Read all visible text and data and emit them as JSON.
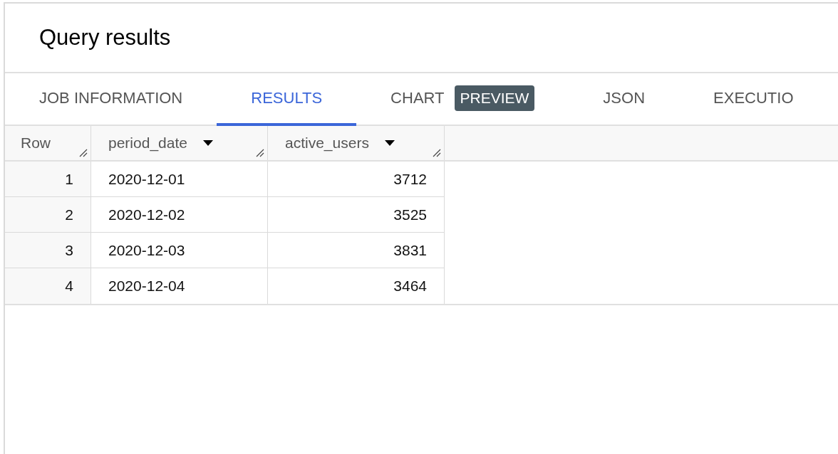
{
  "title": "Query results",
  "tabs": [
    {
      "label": "JOB INFORMATION",
      "selected": false
    },
    {
      "label": "RESULTS",
      "selected": true
    },
    {
      "label": "CHART",
      "badge": "PREVIEW",
      "selected": false
    },
    {
      "label": "JSON",
      "selected": false
    },
    {
      "label": "EXECUTIO",
      "selected": false
    }
  ],
  "table": {
    "columns": [
      {
        "label": "Row",
        "kind": "index",
        "menu": false
      },
      {
        "label": "period_date",
        "kind": "text",
        "menu": true
      },
      {
        "label": "active_users",
        "kind": "number",
        "menu": true
      }
    ],
    "rows": [
      [
        "1",
        "2020-12-01",
        "3712"
      ],
      [
        "2",
        "2020-12-02",
        "3525"
      ],
      [
        "3",
        "2020-12-03",
        "3831"
      ],
      [
        "4",
        "2020-12-04",
        "3464"
      ]
    ]
  }
}
